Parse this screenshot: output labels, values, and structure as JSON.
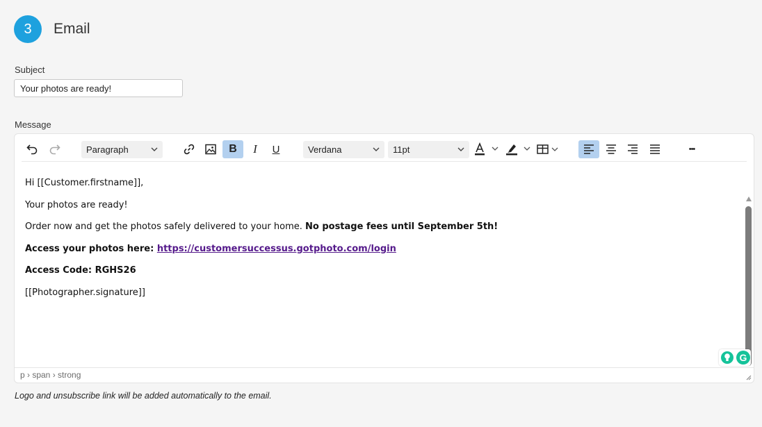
{
  "step": {
    "number": "3",
    "title": "Email"
  },
  "subject": {
    "label": "Subject",
    "value": "Your photos are ready!"
  },
  "message": {
    "label": "Message"
  },
  "toolbar": {
    "undo_icon": "undo-icon",
    "redo_icon": "redo-icon",
    "block_format": "Paragraph",
    "link_icon": "link-icon",
    "image_icon": "image-icon",
    "bold_label": "B",
    "italic_label": "I",
    "underline_label": "U",
    "font_family": "Verdana",
    "font_size": "11pt",
    "text_color": "#222222",
    "highlight_color": "#222222",
    "more_label": "•••",
    "active_color": "#b3d0ef"
  },
  "body": {
    "greeting": "Hi [[Customer.firstname]],",
    "line1": "Your photos are ready!",
    "line2_prefix": "Order now and get the photos safely delivered to your home. ",
    "line2_bold": "No postage fees until September 5th!",
    "access_label": "Access your photos here: ",
    "access_link": "https://customersuccessus.gotphoto.com/login",
    "access_code": "Access Code: RGHS26",
    "signature": "[[Photographer.signature]]"
  },
  "statusbar": {
    "path": "p › span › strong"
  },
  "grammarly": {
    "logo": "G"
  },
  "footnote": "Logo and unsubscribe link will be added automatically to the email.",
  "colors": {
    "accent": "#1ea1de",
    "link": "#551a8b",
    "grammarly": "#15c39a"
  }
}
